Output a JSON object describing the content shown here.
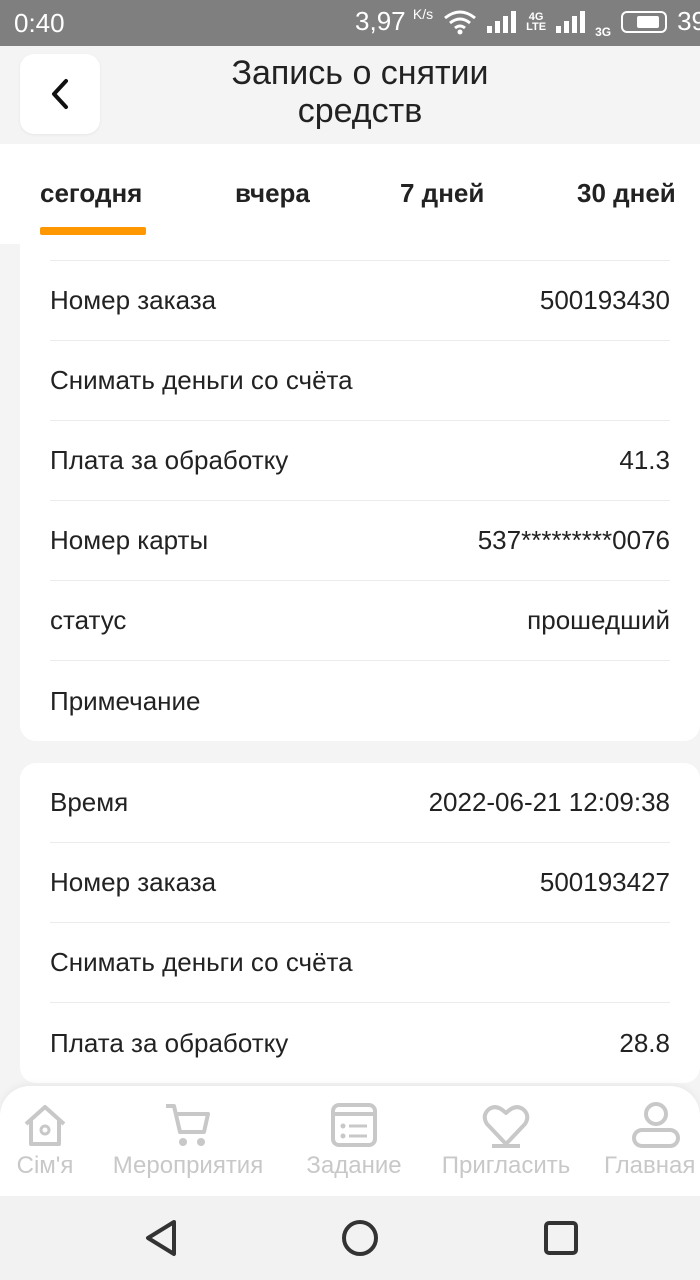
{
  "status_bar": {
    "time": "0:40",
    "speed": "3,97",
    "speed_unit": "K/s",
    "net1": "4G",
    "net1_sub": "LTE",
    "net2": "3G",
    "battery": "39"
  },
  "header": {
    "title_line1": "Запись о снятии",
    "title_line2": "средств"
  },
  "tabs": [
    {
      "label": "сегодня",
      "active": true
    },
    {
      "label": "вчера",
      "active": false
    },
    {
      "label": "7 дней",
      "active": false
    },
    {
      "label": "30 дней",
      "active": false
    }
  ],
  "records": [
    {
      "rows": [
        {
          "label": "Номер заказа",
          "value": "500193430"
        },
        {
          "label": "Снимать деньги со счёта",
          "value": ""
        },
        {
          "label": "Плата за обработку",
          "value": "41.3"
        },
        {
          "label": "Номер карты",
          "value": "537*********0076"
        },
        {
          "label": "статус",
          "value": "прошедший"
        },
        {
          "label": "Примечание",
          "value": ""
        }
      ]
    },
    {
      "rows": [
        {
          "label": "Время",
          "value": "2022-06-21 12:09:38"
        },
        {
          "label": "Номер заказа",
          "value": "500193427"
        },
        {
          "label": "Снимать деньги со счёта",
          "value": ""
        },
        {
          "label": "Плата за обработку",
          "value": "28.8"
        }
      ]
    }
  ],
  "bottom_nav": [
    {
      "label": "Сім'я",
      "icon": "home-icon"
    },
    {
      "label": "Мероприятия",
      "icon": "cart-icon"
    },
    {
      "label": "Задание",
      "icon": "task-list-icon"
    },
    {
      "label": "Пригласить",
      "icon": "heart-icon"
    },
    {
      "label": "Главная",
      "icon": "user-icon"
    }
  ],
  "colors": {
    "accent": "#ff9800",
    "status_bar": "#7f7f7f",
    "nav_inactive": "#c8c8c8"
  }
}
